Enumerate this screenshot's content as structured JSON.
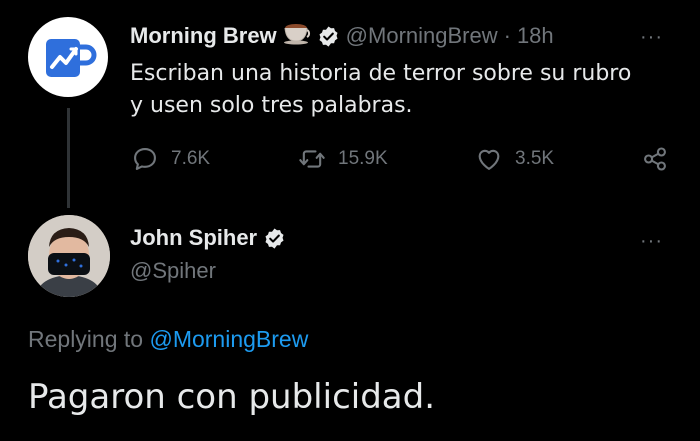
{
  "tweet": {
    "author_name": "Morning Brew",
    "author_handle": "@MorningBrew",
    "separator": "·",
    "time": "18h",
    "text_line1": "Escriban una historia de terror sobre su rubro",
    "text_line2": "y usen solo tres palabras.",
    "replies": "7.6K",
    "retweets": "15.9K",
    "likes": "3.5K",
    "more": "···"
  },
  "reply": {
    "author_name": "John Spiher",
    "author_handle": "@Spiher",
    "more": "···",
    "replying_prefix": "Replying to",
    "replying_handle": "@MorningBrew",
    "text": "Pagaron con publicidad."
  },
  "colors": {
    "background": "#000000",
    "text": "#e7e9ea",
    "muted": "#71767b",
    "link": "#1d9bf0",
    "brand_blue": "#2f6fdc"
  },
  "icons": {
    "reply": "reply-icon",
    "retweet": "retweet-icon",
    "like": "heart-icon",
    "share": "share-icon",
    "verified": "verified-badge-icon",
    "coffee": "coffee-cup-emoji-icon"
  }
}
